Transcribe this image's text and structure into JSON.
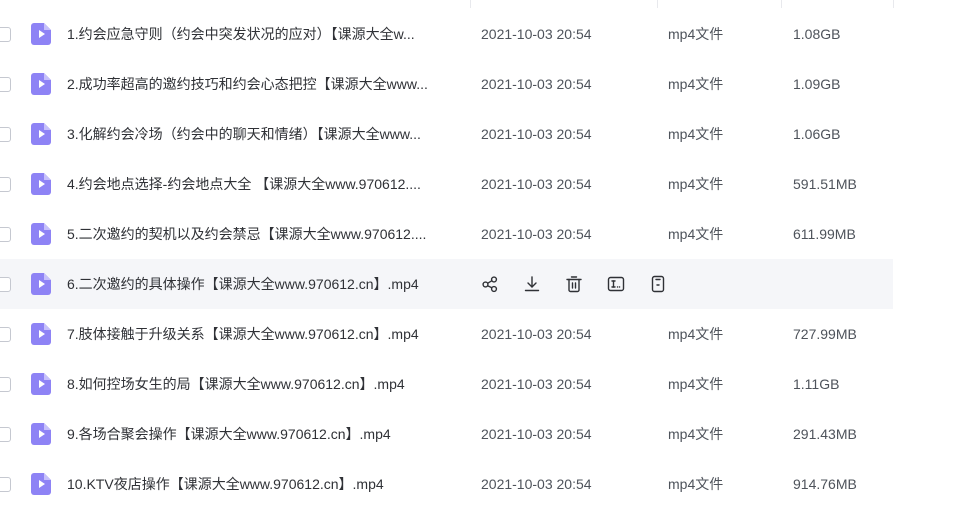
{
  "colors": {
    "file_icon": "#8e83f5",
    "hover_row": "#f5f6f9",
    "name_text": "#2f3136",
    "meta_text": "#4e535b"
  },
  "file_icon": "video-file-icon",
  "files": [
    {
      "name": "1.约会应急守则（约会中突发状况的应对）【课源大全w...",
      "modified": "2021-10-03 20:54",
      "type": "mp4文件",
      "size": "1.08GB"
    },
    {
      "name": "2.成功率超高的邀约技巧和约会心态把控【课源大全www...",
      "modified": "2021-10-03 20:54",
      "type": "mp4文件",
      "size": "1.09GB"
    },
    {
      "name": "3.化解约会冷场（约会中的聊天和情绪）【课源大全www...",
      "modified": "2021-10-03 20:54",
      "type": "mp4文件",
      "size": "1.06GB"
    },
    {
      "name": "4.约会地点选择-约会地点大全 【课源大全www.970612....",
      "modified": "2021-10-03 20:54",
      "type": "mp4文件",
      "size": "591.51MB"
    },
    {
      "name": "5.二次邀约的契机以及约会禁忌【课源大全www.970612....",
      "modified": "2021-10-03 20:54",
      "type": "mp4文件",
      "size": "611.99MB"
    },
    {
      "name": "6.二次邀约的具体操作【课源大全www.970612.cn】.mp4",
      "state": "hovered"
    },
    {
      "name": "7.肢体接触于升级关系【课源大全www.970612.cn】.mp4",
      "modified": "2021-10-03 20:54",
      "type": "mp4文件",
      "size": "727.99MB"
    },
    {
      "name": "8.如何控场女生的局【课源大全www.970612.cn】.mp4",
      "modified": "2021-10-03 20:54",
      "type": "mp4文件",
      "size": "1.11GB"
    },
    {
      "name": "9.各场合聚会操作【课源大全www.970612.cn】.mp4",
      "modified": "2021-10-03 20:54",
      "type": "mp4文件",
      "size": "291.43MB"
    },
    {
      "name": "10.KTV夜店操作【课源大全www.970612.cn】.mp4",
      "modified": "2021-10-03 20:54",
      "type": "mp4文件",
      "size": "914.76MB"
    }
  ],
  "hover_actions": [
    "share-icon",
    "download-icon",
    "delete-icon",
    "rename-icon",
    "clipboard-icon"
  ]
}
